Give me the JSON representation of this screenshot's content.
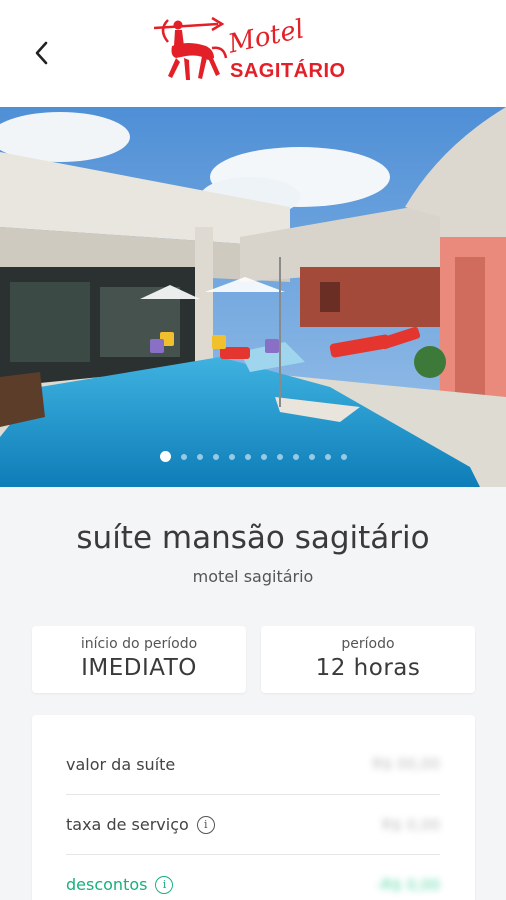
{
  "header": {
    "logo_script": "Motel",
    "logo_word": "SAGITÁRIO"
  },
  "carousel": {
    "total_images": 12,
    "active_index": 0
  },
  "suite": {
    "title": "suíte mansão sagitário",
    "motel": "motel sagitário"
  },
  "period": {
    "start_label": "início do período",
    "start_value": "IMEDIATO",
    "duration_label": "período",
    "duration_value": "12 horas"
  },
  "pricing": {
    "rows": [
      {
        "label": "valor da suíte",
        "value": "R$ 00,00"
      },
      {
        "label": "taxa de serviço",
        "value": "R$ 0,00"
      },
      {
        "label": "descontos",
        "value": "-R$ 0,00"
      }
    ]
  },
  "colors": {
    "brand_red": "#e32028",
    "discount_green": "#19b07a",
    "background": "#f4f5f7"
  },
  "icons": {
    "back": "chevron-left-icon",
    "info": "info-circle-icon"
  }
}
